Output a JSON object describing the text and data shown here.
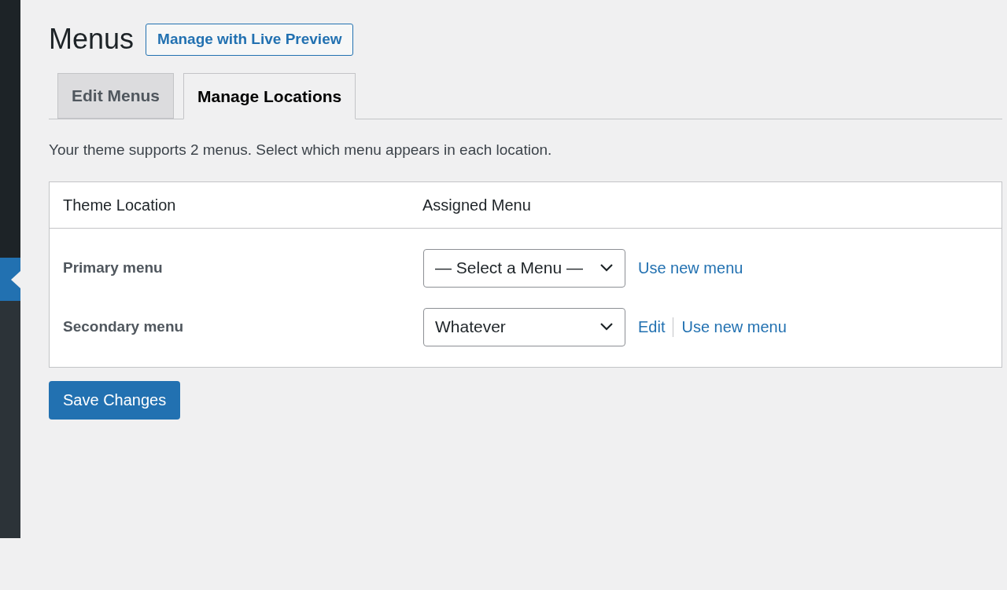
{
  "page": {
    "title": "Menus",
    "action_button": "Manage with Live Preview"
  },
  "tabs": [
    {
      "label": "Edit Menus",
      "selected": false
    },
    {
      "label": "Manage Locations",
      "selected": true
    }
  ],
  "description": "Your theme supports 2 menus. Select which menu appears in each location.",
  "table": {
    "columns": [
      "Theme Location",
      "Assigned Menu"
    ],
    "rows": [
      {
        "location": "Primary menu",
        "select_value": "— Select a Menu —",
        "links": [
          "Use new menu"
        ]
      },
      {
        "location": "Secondary menu",
        "select_value": "Whatever",
        "links": [
          "Edit",
          "Use new menu"
        ]
      }
    ]
  },
  "save_button": "Save Changes"
}
